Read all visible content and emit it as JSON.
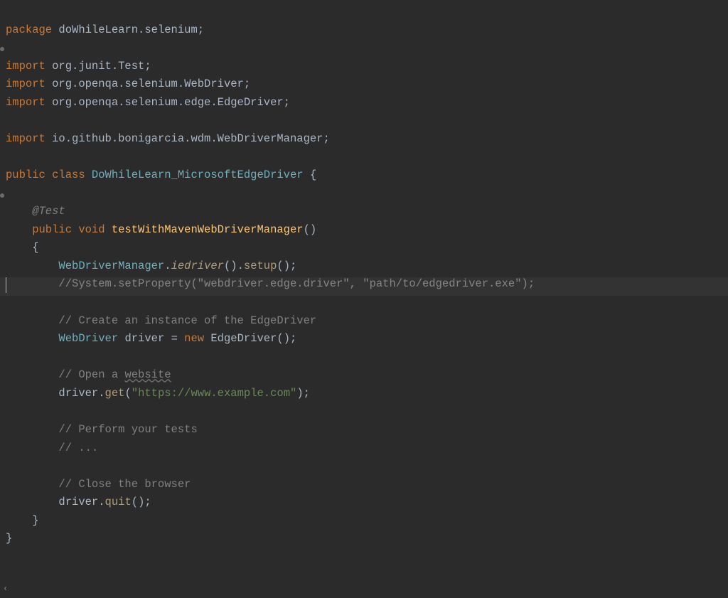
{
  "code": {
    "l1_kw": "package",
    "l1_pkg": " doWhileLearn.selenium;",
    "l3_kw": "import",
    "l3_rest": " org.junit.Test;",
    "l4_kw": "import",
    "l4_rest": " org.openqa.selenium.WebDriver;",
    "l5_kw": "import",
    "l5_rest": " org.openqa.selenium.edge.EdgeDriver;",
    "l7_kw": "import",
    "l7_rest": " io.github.bonigarcia.wdm.WebDriverManager;",
    "l9_kw1": "public",
    "l9_kw2": " class",
    "l9_cls": " DoWhileLearn_MicrosoftEdgeDriver",
    "l9_brace": " {",
    "l11_anno": "    @Test",
    "l12_kw1": "    public",
    "l12_kw2": " void",
    "l12_method": " testWithMavenWebDriverManager",
    "l12_parens": "()",
    "l13_brace": "    {",
    "l14_type": "        WebDriverManager",
    "l14_dot1": ".",
    "l14_call1": "iedriver",
    "l14_p1": "().",
    "l14_call2": "setup",
    "l14_p2": "();",
    "l15_comment": "        //System.setProperty(\"webdriver.edge.driver\", \"path/to/edgedriver.exe\");",
    "l17_comment": "        // Create an instance of the EdgeDriver",
    "l18_type": "        WebDriver",
    "l18_var": " driver",
    "l18_eq": " = ",
    "l18_new": "new",
    "l18_ctor": " EdgeDriver",
    "l18_p": "();",
    "l20_c1": "        // Open a ",
    "l20_c2": "website",
    "l21_obj": "        driver",
    "l21_dot": ".",
    "l21_m": "get",
    "l21_p1": "(",
    "l21_str": "\"https://www.example.com\"",
    "l21_p2": ");",
    "l23_comment": "        // Perform your tests",
    "l24_comment": "        // ...",
    "l26_comment": "        // Close the browser",
    "l27_obj": "        driver",
    "l27_dot": ".",
    "l27_m": "quit",
    "l27_p": "();",
    "l28_brace": "    }",
    "l29_brace": "}"
  },
  "footer": {
    "arrow": "‹"
  }
}
